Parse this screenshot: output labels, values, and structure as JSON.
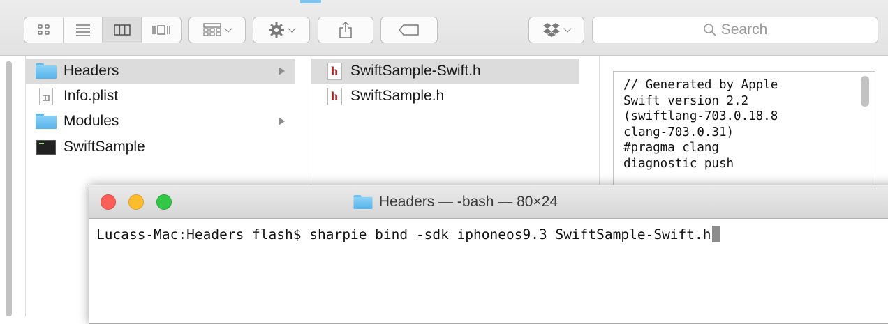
{
  "toolbar": {
    "search_placeholder": "Search",
    "view_buttons": [
      "icon-view",
      "list-view",
      "column-view",
      "cover-flow-view"
    ],
    "active_view": "column-view"
  },
  "columns": {
    "col1": [
      {
        "label": "Headers",
        "icon": "folder-icon",
        "selected": true,
        "has_children": true
      },
      {
        "label": "Info.plist",
        "icon": "plist-file-icon",
        "selected": false,
        "has_children": false
      },
      {
        "label": "Modules",
        "icon": "folder-icon",
        "selected": false,
        "has_children": true
      },
      {
        "label": "SwiftSample",
        "icon": "executable-icon",
        "selected": false,
        "has_children": false
      }
    ],
    "col2": [
      {
        "label": "SwiftSample-Swift.h",
        "icon": "header-file-icon",
        "selected": true
      },
      {
        "label": "SwiftSample.h",
        "icon": "header-file-icon",
        "selected": false
      }
    ]
  },
  "preview": {
    "lines": [
      "// Generated by Apple",
      "Swift version 2.2",
      "(swiftlang-703.0.18.8",
      "clang-703.0.31)",
      "#pragma clang",
      "diagnostic push"
    ]
  },
  "terminal": {
    "title": "Headers — -bash — 80×24",
    "prompt": "Lucass-Mac:Headers flash$ ",
    "command": "sharpie bind -sdk iphoneos9.3 SwiftSample-Swift.h"
  },
  "colors": {
    "close": "#fc5f57",
    "minimize": "#fdbc2e",
    "zoom": "#33c748",
    "folder": "#5ab5ea",
    "selection": "#dcdcdc"
  }
}
